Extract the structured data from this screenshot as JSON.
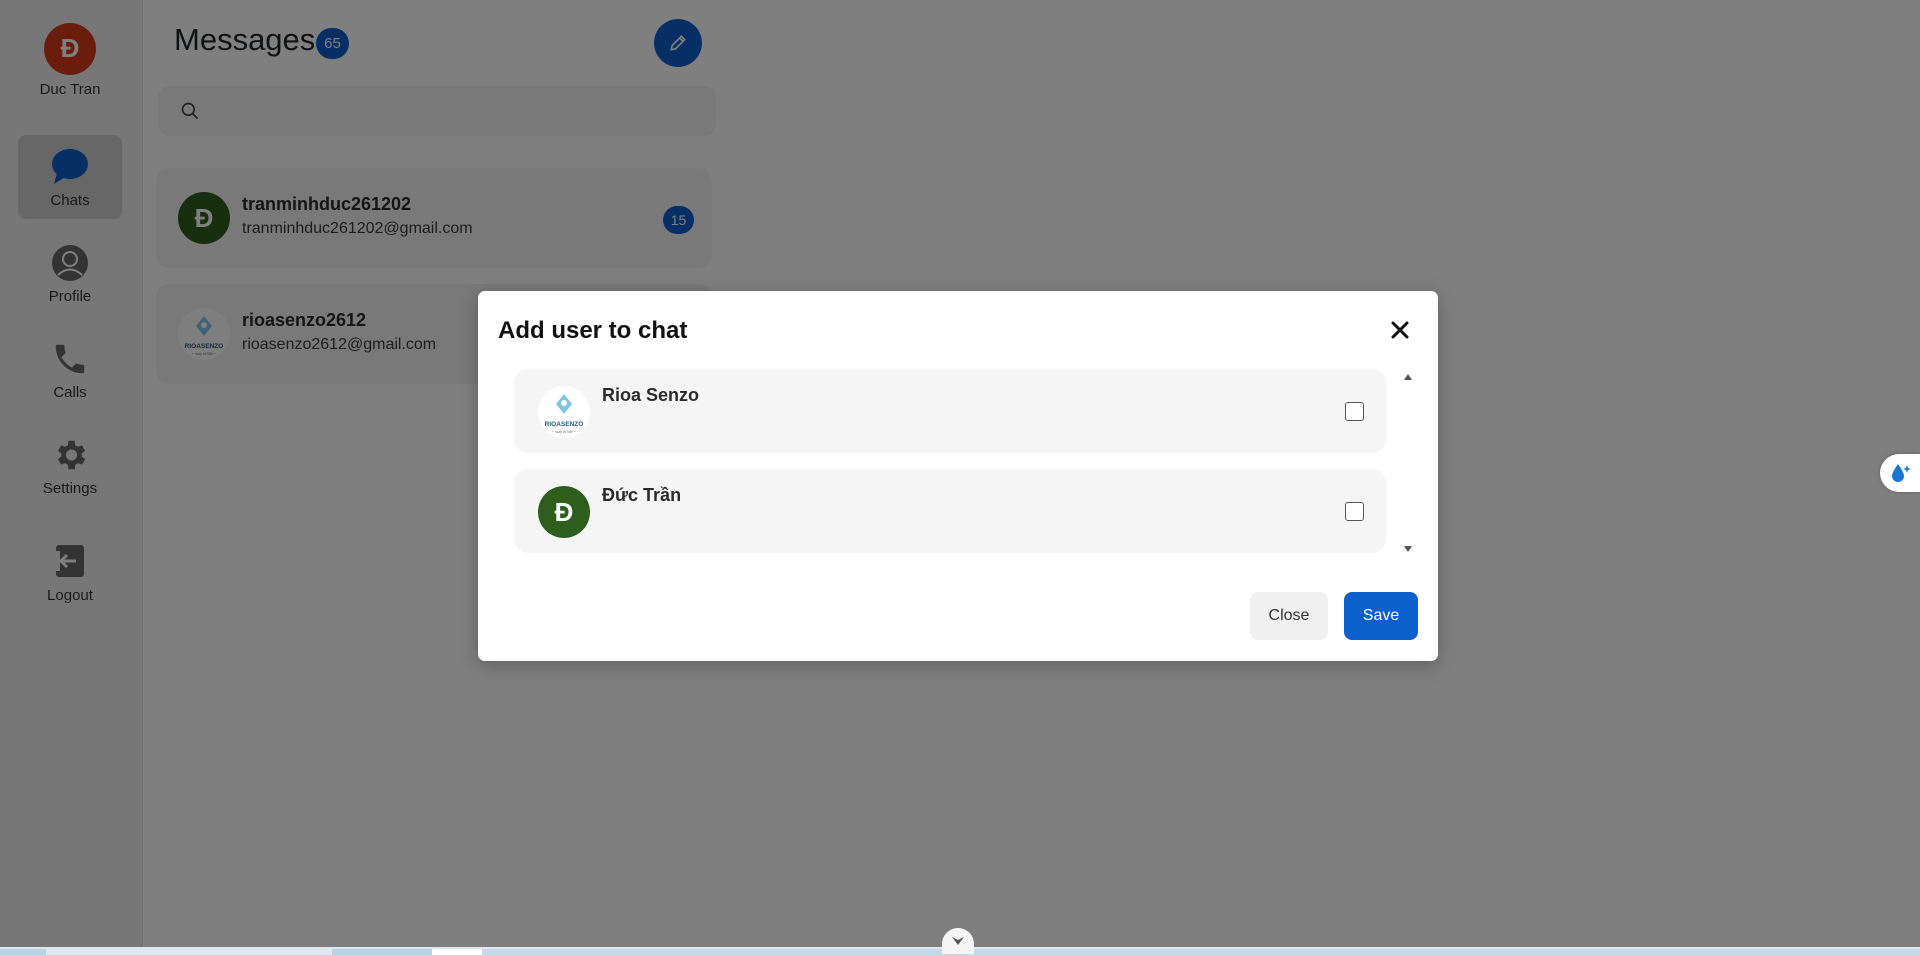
{
  "sidebar": {
    "user": {
      "initial": "Đ",
      "name": "Duc Tran",
      "avatar_color": "#d43a1a"
    },
    "items": [
      {
        "label": "Chats",
        "icon": "chat-bubble-icon",
        "active": true
      },
      {
        "label": "Profile",
        "icon": "user-circle-icon"
      },
      {
        "label": "Calls",
        "icon": "phone-icon"
      },
      {
        "label": "Settings",
        "icon": "gear-icon"
      },
      {
        "label": "Logout",
        "icon": "logout-icon"
      }
    ]
  },
  "messages": {
    "title": "Messages",
    "unread_count": "65",
    "search_placeholder": "",
    "chats": [
      {
        "initial": "Đ",
        "name": "tranminhduc261202",
        "email": "tranminhduc261202@gmail.com",
        "unread": "15"
      },
      {
        "name": "rioasenzo2612",
        "email": "rioasenzo2612@gmail.com",
        "logo": "RIOASENZO",
        "logo_tagline": "~ way of life ~"
      }
    ]
  },
  "modal": {
    "title": "Add user to chat",
    "users": [
      {
        "name": "Rioa Senzo",
        "logo": "RIOASENZO",
        "logo_tagline": "~ way of life ~",
        "checked": false
      },
      {
        "name": "Đức Trần",
        "initial": "Đ",
        "checked": false
      }
    ],
    "close_label": "Close",
    "save_label": "Save"
  },
  "colors": {
    "primary": "#0d5fcc",
    "avatar_green": "#2e5e1c",
    "avatar_red": "#d43a1a",
    "overlay": "rgba(0,0,0,0.5)"
  }
}
